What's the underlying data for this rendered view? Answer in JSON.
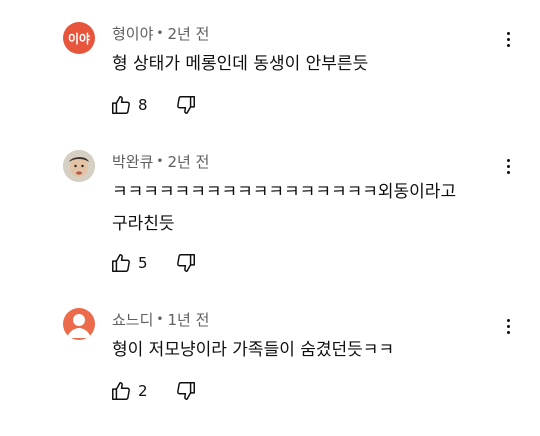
{
  "comments": [
    {
      "author": "형이야",
      "time": "2년 전",
      "avatar_text": "이야",
      "avatar_color": "#e8553d",
      "text": "형 상태가 메롱인데 동생이 안부른듯",
      "likes": "8"
    },
    {
      "author": "박완큐",
      "time": "2년 전",
      "avatar_text": "",
      "avatar_color": "#c9c3b8",
      "text": "ㅋㅋㅋㅋㅋㅋㅋㅋㅋㅋㅋㅋㅋㅋㅋㅋㅋ외동이라고 구라친듯",
      "likes": "5"
    },
    {
      "author": "쇼느디",
      "time": "1년 전",
      "avatar_text": "",
      "avatar_color": "#ec6b4b",
      "text": "형이 저모냥이라 가족들이 숨겼던듯ㅋㅋ",
      "likes": "2"
    }
  ]
}
